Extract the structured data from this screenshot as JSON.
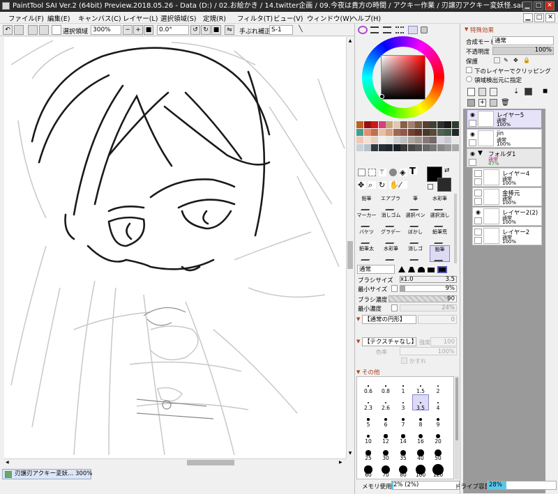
{
  "window": {
    "title": "PaintTool SAI Ver.2 (64bit) Preview.2018.05.26 - Data (D:) / 02.お絵かき / 14.twitter企画 / 09.今夜は貴方の時間 / アクキー作業 / 刃譲刃アクキー変妖怪.sai2",
    "min": "▁",
    "max": "□",
    "close": "✕"
  },
  "menubar": {
    "items": [
      "ファイル(F)",
      "編集(E)",
      "キャンバス(C)",
      "レイヤー(L)",
      "選択領域(S)",
      "定規(R)",
      "フィルタ(T)",
      "ビュー(V)",
      "ウィンドウ(W)",
      "ヘルプ(H)"
    ],
    "mdi_min": "▁",
    "mdi_max": "□",
    "mdi_close": "✕"
  },
  "toolbar": {
    "selection_label": "選択領域",
    "zoom": "300%",
    "minus": "−",
    "plus": "+",
    "rotation": "0.0°",
    "stabilizer_label": "手ぶれ補正",
    "stabilizer": "S-1"
  },
  "docbar": {
    "tab_title": "刃譲刃アクキー変妖...",
    "tab_zoom": "300%"
  },
  "colors": {
    "swatches": [
      "#c06020",
      "#9a1010",
      "#cc1818",
      "#d44080",
      "#c8a878",
      "#e0c8b0",
      "#886044",
      "#a08070",
      "#7a5a40",
      "#5a4030",
      "#404038",
      "#303030",
      "#1a1a1a",
      "#303a30",
      "#40a090",
      "#e09070",
      "#c07050",
      "#e8c0a0",
      "#d8a080",
      "#a06850",
      "#905848",
      "#704030",
      "#603028",
      "#483828",
      "#584838",
      "#506050",
      "#405848",
      "#202828",
      "#f0c8b8",
      "#f8e0d0",
      "#e8d0c0",
      "#f0f0f0",
      "#e8e8e8",
      "#d0d0d0",
      "#c0c0c0",
      "#b0a8a0",
      "#a09890",
      "#887878",
      "#786868",
      "#d8d8e0",
      "#c8c8d0",
      "#e8e8e8",
      "#c8d0d8",
      "#b8c0c8",
      "#303840",
      "#283038",
      "#202830",
      "#182028",
      "#383838",
      "#484848",
      "#585858",
      "#686868",
      "#787878",
      "#888888",
      "#989898",
      "#a8a8a8"
    ],
    "primary": "#000000",
    "secondary": "#2a2a2a",
    "hue_marker": "#8a1818"
  },
  "brushes": {
    "tools": [
      {
        "label": "鉛筆"
      },
      {
        "label": "エアブラシ"
      },
      {
        "label": "筆"
      },
      {
        "label": "水彩筆"
      },
      {
        "label": "マーカー"
      },
      {
        "label": "消しゴム"
      },
      {
        "label": "選択ペン"
      },
      {
        "label": "選択消し"
      },
      {
        "label": "バケツ"
      },
      {
        "label": "グラデーション"
      },
      {
        "label": "ぼかし"
      },
      {
        "label": "鉛筆荒"
      },
      {
        "label": "鉛筆太"
      },
      {
        "label": "水彩筆"
      },
      {
        "label": "消しゴ"
      },
      {
        "label": "鉛筆"
      }
    ],
    "mode": "通常",
    "size_label": "ブラシサイズ",
    "size_mult": "x1.0",
    "size_value": "3.5",
    "min_size_label": "最小サイズ",
    "min_size_value": "9%",
    "density_label": "ブラシ濃度",
    "density_value": "90",
    "min_density_label": "最小濃度",
    "min_density_value": "24%",
    "shape": "【通常の円形】",
    "shape_value": "0",
    "texture": "【テクスチャなし】",
    "texture_strength_label": "強度",
    "texture_strength": "100",
    "pattern_label": "色率",
    "pattern_value": "100%",
    "blur_label": "かすれ",
    "other_section": "その他",
    "dot_labels": [
      "0.6",
      "0.8",
      "1",
      "1.5",
      "2",
      "2.3",
      "2.6",
      "3",
      "3.5",
      "4",
      "5",
      "6",
      "7",
      "8",
      "9",
      "10",
      "12",
      "14",
      "16",
      "20",
      "25",
      "30",
      "35",
      "40",
      "50",
      "60",
      "70",
      "80",
      "100",
      "120"
    ],
    "selected_dot": "3.5"
  },
  "status": {
    "memory_label": "メモリ使用量",
    "memory_value": "2% (2%)",
    "memory_fraction": 0.02,
    "drive_label": "ドライブ容量",
    "drive_value": "28%",
    "drive_fraction": 0.28
  },
  "layers_panel": {
    "effect_section": "特殊効果",
    "blend_label": "合成モード",
    "blend_value": "通常",
    "opacity_label": "不透明度",
    "opacity_value": "100%",
    "protect_label": "保護",
    "clip_label": "下のレイヤーでクリッピング",
    "source_label": "領域検出元に指定",
    "layers": [
      {
        "name": "レイヤー5",
        "mode": "通常",
        "opacity": "100%",
        "selected": true,
        "visible": true,
        "indent": false
      },
      {
        "name": "jin",
        "mode": "通常",
        "opacity": "100%",
        "selected": false,
        "visible": true,
        "indent": false
      },
      {
        "name": "フォルダ1",
        "mode": "通常",
        "opacity": "47%",
        "selected": false,
        "visible": true,
        "indent": false,
        "folder": true
      },
      {
        "name": "レイヤー4",
        "mode": "通常",
        "opacity": "100%",
        "selected": false,
        "visible": false,
        "indent": true
      },
      {
        "name": "金棒元",
        "mode": "通常",
        "opacity": "100%",
        "selected": false,
        "visible": false,
        "indent": true
      },
      {
        "name": "レイヤー2(2)",
        "mode": "通常",
        "opacity": "100%",
        "selected": false,
        "visible": true,
        "indent": true
      },
      {
        "name": "レイヤー2",
        "mode": "通常",
        "opacity": "100%",
        "selected": false,
        "visible": false,
        "indent": true
      }
    ]
  }
}
